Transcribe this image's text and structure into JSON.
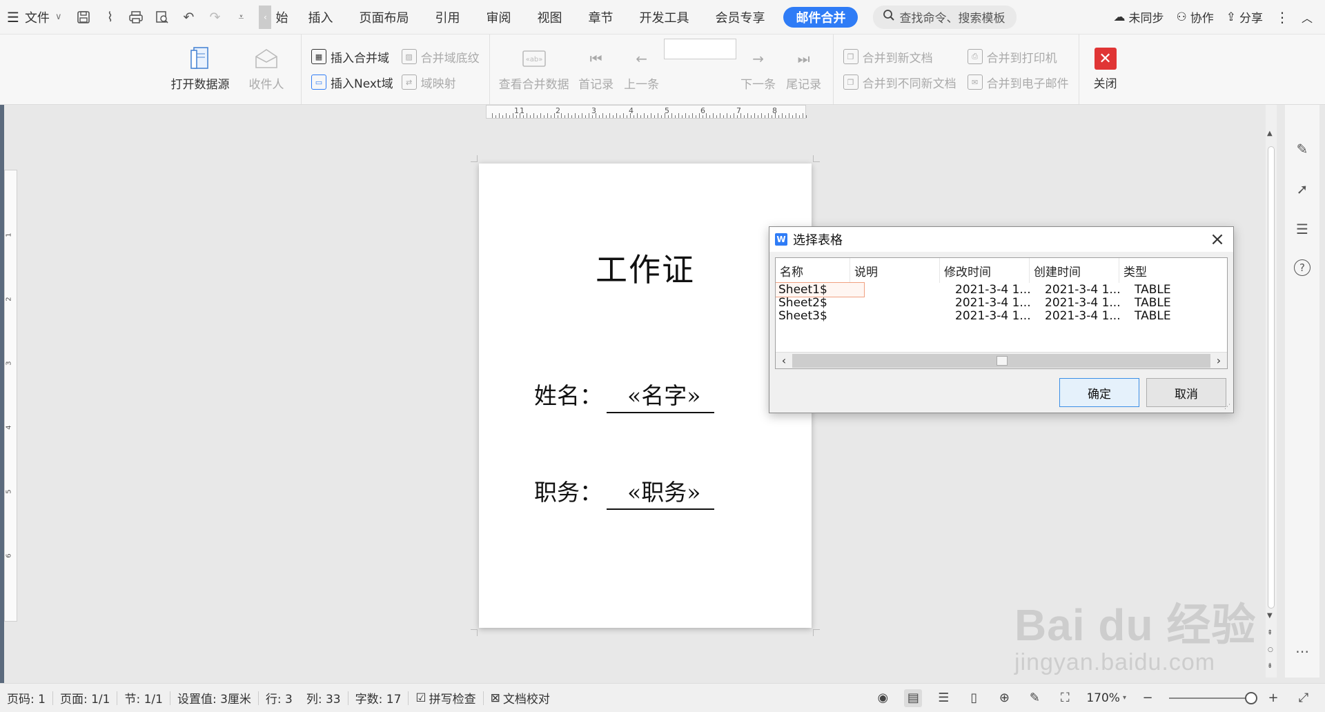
{
  "menubar": {
    "file_label": "文件",
    "tabs": [
      {
        "label": "始"
      },
      {
        "label": "插入"
      },
      {
        "label": "页面布局"
      },
      {
        "label": "引用"
      },
      {
        "label": "审阅"
      },
      {
        "label": "视图"
      },
      {
        "label": "章节"
      },
      {
        "label": "开发工具"
      },
      {
        "label": "会员专享"
      },
      {
        "label": "邮件合并"
      }
    ],
    "search_placeholder": "查找命令、搜索模板",
    "sync_label": "未同步",
    "collab_label": "协作",
    "share_label": "分享"
  },
  "ribbon": {
    "open_datasource": "打开数据源",
    "recipients": "收件人",
    "insert_merge_field": "插入合并域",
    "merge_field_shading": "合并域底纹",
    "insert_next_field": "插入Next域",
    "field_mapping": "域映射",
    "view_merged_data": "查看合并数据",
    "first_record": "首记录",
    "prev_record": "上一条",
    "next_record": "下一条",
    "last_record": "尾记录",
    "merge_new_doc": "合并到新文档",
    "merge_diff_docs": "合并到不同新文档",
    "merge_printer": "合并到打印机",
    "merge_email": "合并到电子邮件",
    "close": "关闭"
  },
  "ruler": {
    "h_numbers": [
      "1",
      "1",
      "2",
      "3",
      "4",
      "5",
      "6",
      "7",
      "8"
    ],
    "v_numbers": [
      "1",
      "2",
      "3",
      "4",
      "5",
      "6"
    ]
  },
  "document": {
    "title": "工作证",
    "name_label": "姓名：",
    "name_value": "«名字»",
    "job_label": "职务：",
    "job_value": "«职务»"
  },
  "dialog": {
    "title": "选择表格",
    "columns": [
      "名称",
      "说明",
      "修改时间",
      "创建时间",
      "类型"
    ],
    "rows": [
      {
        "name": "Sheet1$",
        "desc": "",
        "modified": "2021-3-4 1...",
        "created": "2021-3-4 1...",
        "type": "TABLE"
      },
      {
        "name": "Sheet2$",
        "desc": "",
        "modified": "2021-3-4 1...",
        "created": "2021-3-4 1...",
        "type": "TABLE"
      },
      {
        "name": "Sheet3$",
        "desc": "",
        "modified": "2021-3-4 1...",
        "created": "2021-3-4 1...",
        "type": "TABLE"
      }
    ],
    "ok_label": "确定",
    "cancel_label": "取消"
  },
  "statusbar": {
    "page_code": "页码: 1",
    "page": "页面: 1/1",
    "section": "节: 1/1",
    "setting": "设置值: 3厘米",
    "row": "行: 3",
    "col": "列: 33",
    "word_count": "字数: 17",
    "spell_check": "拼写检查",
    "doc_review": "文档校对",
    "zoom": "170%"
  },
  "watermark": {
    "line1": "Bai du 经验",
    "line2": "jingyan.baidu.com"
  },
  "colors": {
    "accent": "#2f7cf6",
    "close_red": "#e03535",
    "selection_outline": "#f0a080"
  }
}
